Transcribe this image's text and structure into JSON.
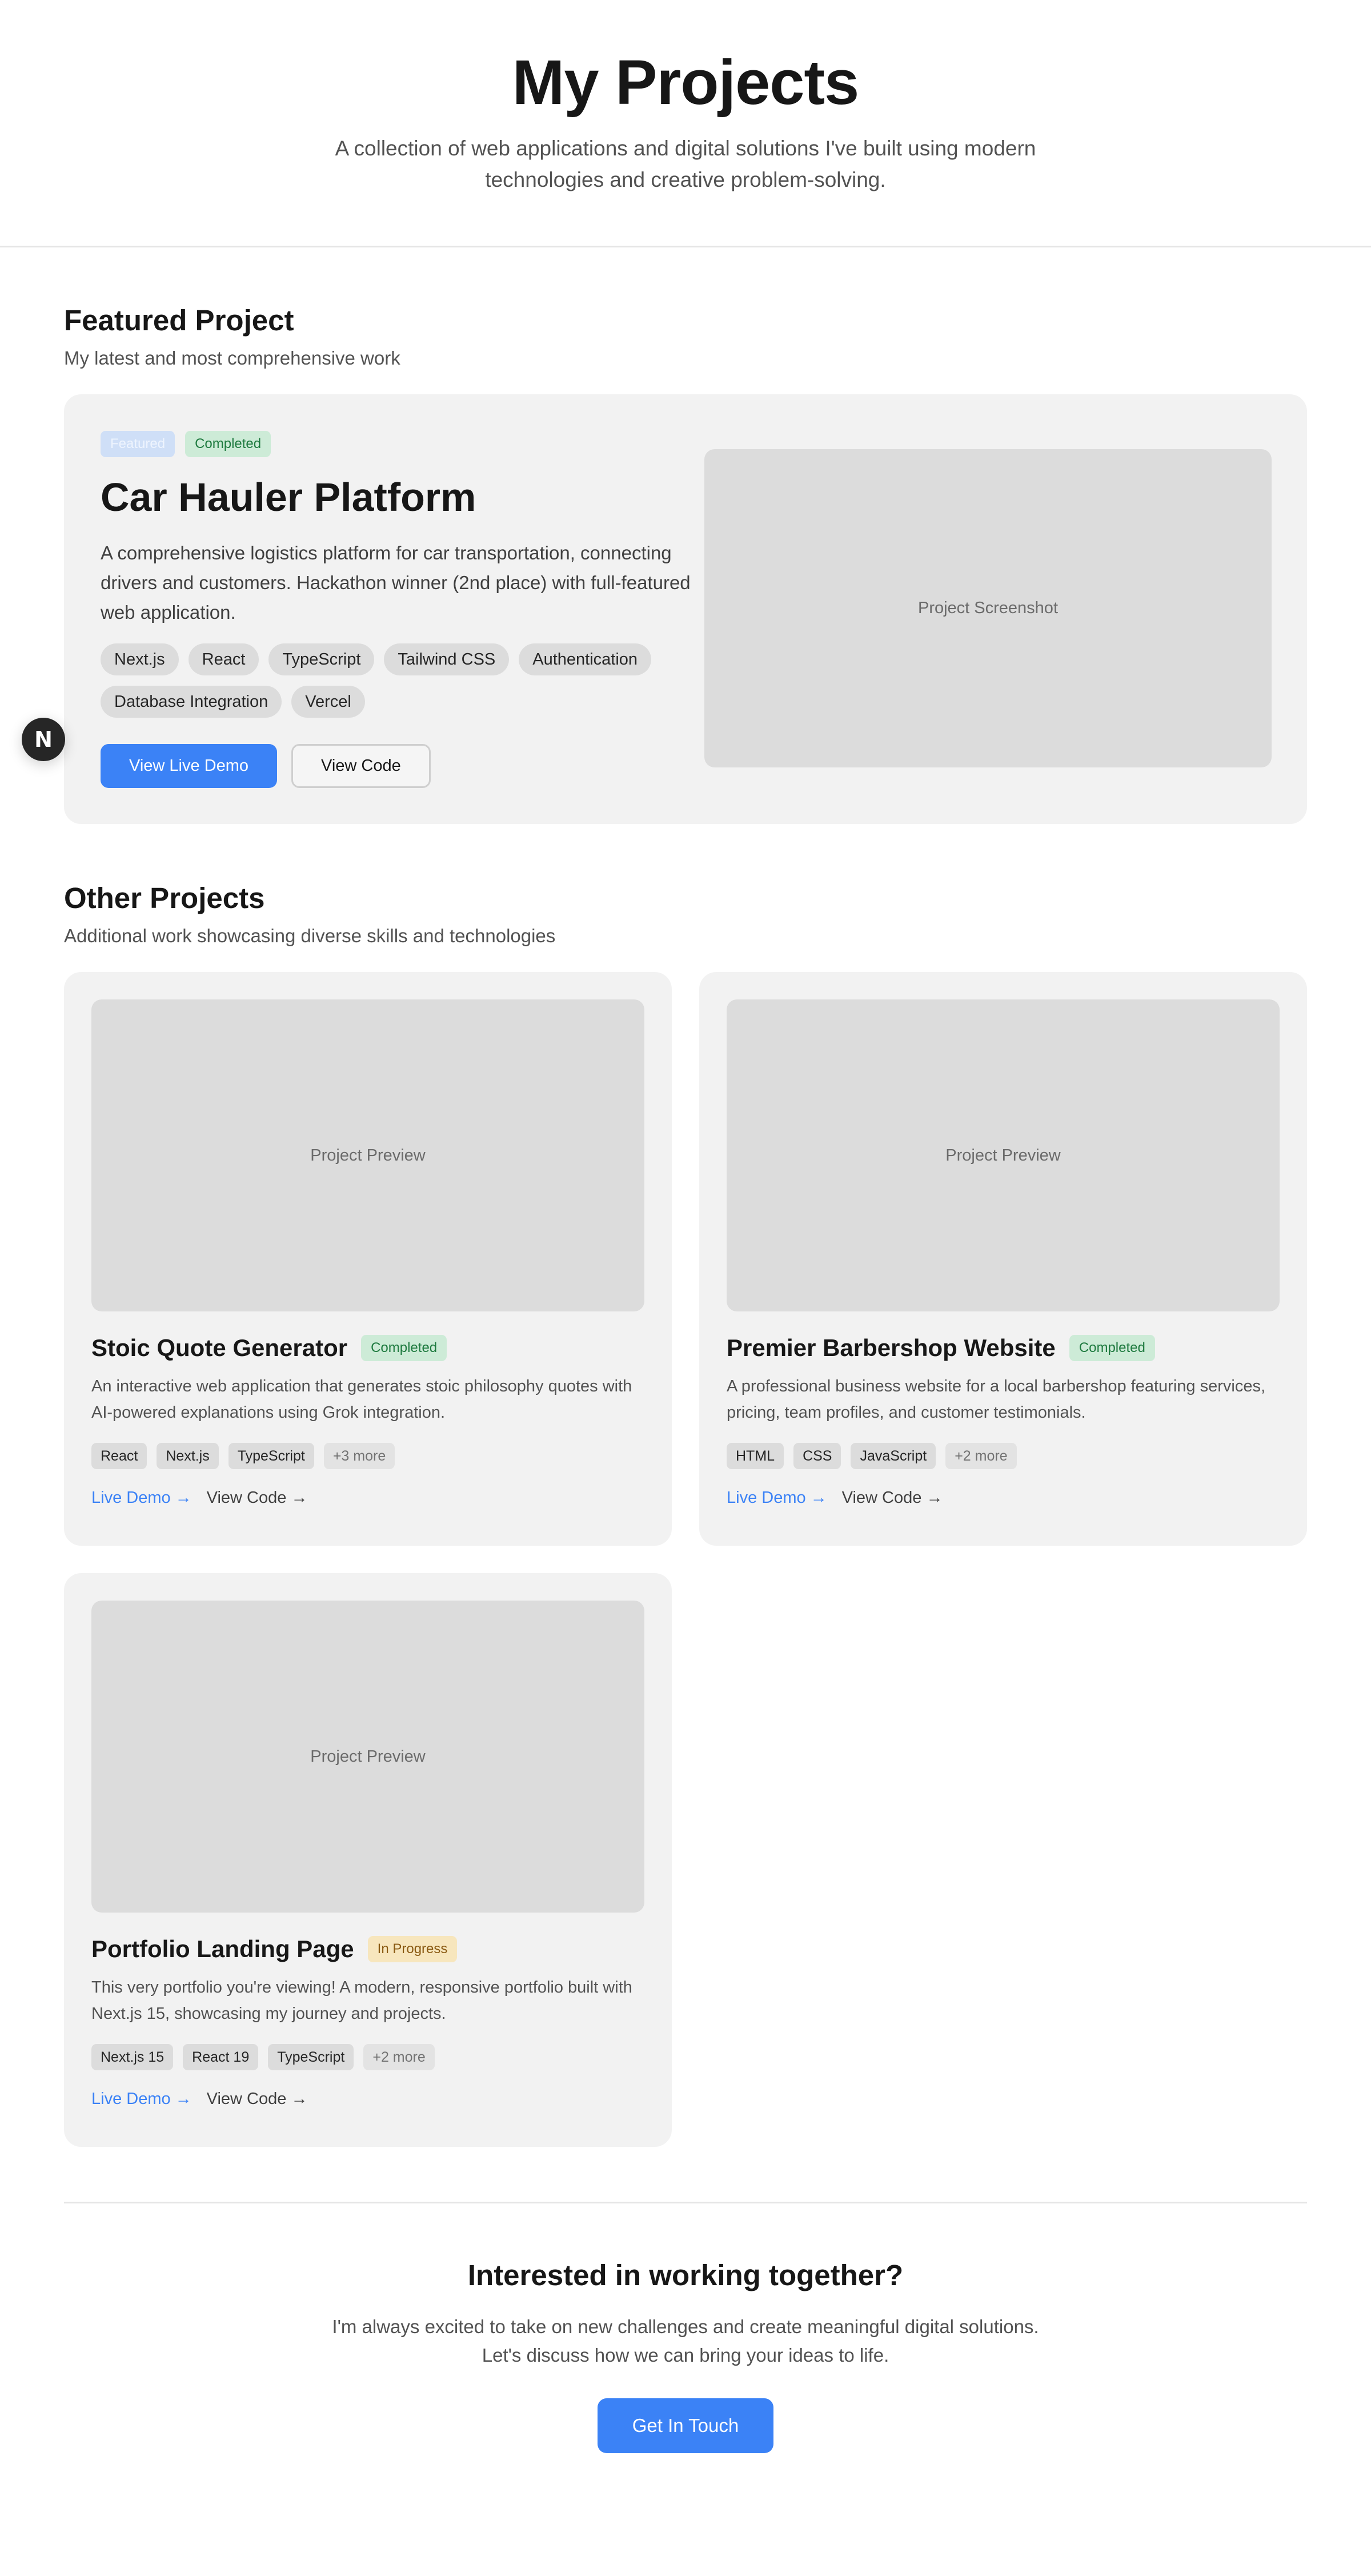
{
  "hero": {
    "title": "My Projects",
    "subtitle": "A collection of web applications and digital solutions I've built using modern technologies and creative problem-solving."
  },
  "featured": {
    "heading": "Featured Project",
    "subheading": "My latest and most comprehensive work",
    "badges": [
      "Featured",
      "Completed"
    ],
    "title": "Car Hauler Platform",
    "description": "A comprehensive logistics platform for car transportation, connecting drivers and customers. Hackathon winner (2nd place) with full-featured web application.",
    "technologies": [
      "Next.js",
      "React",
      "TypeScript",
      "Tailwind CSS",
      "Authentication",
      "Database Integration",
      "Vercel"
    ],
    "demo_label": "View Live Demo",
    "code_label": "View Code",
    "screenshot_label": "Project Screenshot"
  },
  "other": {
    "heading": "Other Projects",
    "subheading": "Additional work showcasing diverse skills and technologies",
    "preview_label": "Project Preview",
    "demo_link": "Live Demo →",
    "code_link": "View Code →",
    "projects": [
      {
        "title": "Stoic Quote Generator",
        "status": "Completed",
        "description": "An interactive web application that generates stoic philosophy quotes with AI-powered explanations using Grok integration.",
        "tags": [
          "React",
          "Next.js",
          "TypeScript"
        ],
        "more": "+3 more"
      },
      {
        "title": "Premier Barbershop Website",
        "status": "Completed",
        "description": "A professional business website for a local barbershop featuring services, pricing, team profiles, and customer testimonials.",
        "tags": [
          "HTML",
          "CSS",
          "JavaScript"
        ],
        "more": "+2 more"
      },
      {
        "title": "Portfolio Landing Page",
        "status": "In Progress",
        "description": "This very portfolio you're viewing! A modern, responsive portfolio built with Next.js 15, showcasing my journey and projects.",
        "tags": [
          "Next.js 15",
          "React 19",
          "TypeScript"
        ],
        "more": "+2 more"
      }
    ]
  },
  "cta": {
    "title": "Interested in working together?",
    "text": "I'm always excited to take on new challenges and create meaningful digital solutions. Let's discuss how we can bring your ideas to life.",
    "button": "Get In Touch"
  },
  "nav_toggle": {
    "glyph": "N",
    "icon": "nextjs-logo-icon"
  },
  "colors": {
    "accent": "#3b82f6",
    "card_bg": "#f2f2f2",
    "completed": "#cdebd7",
    "in_progress": "#f7e6bd"
  }
}
